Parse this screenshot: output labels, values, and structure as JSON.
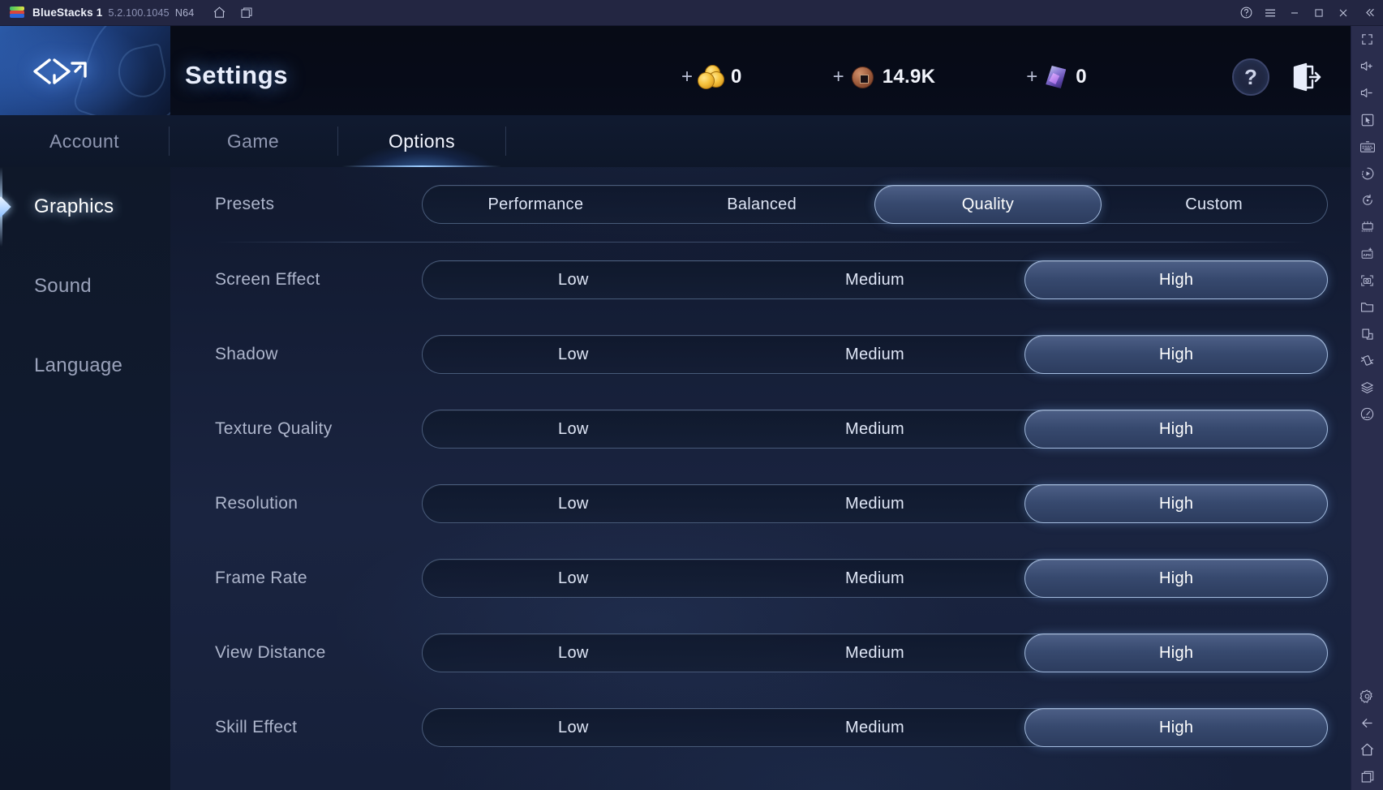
{
  "titlebar": {
    "app_name": "BlueStacks 1",
    "version": "5.2.100.1045",
    "instance": "N64",
    "icons": {
      "home": "home-icon",
      "instances": "instance-manager-icon",
      "help": "help-icon",
      "menu": "hamburger-menu-icon",
      "minimize": "minimize-icon",
      "maximize": "maximize-icon",
      "close": "close-icon",
      "collapse": "collapse-icon"
    }
  },
  "sidetool": {
    "items": [
      {
        "name": "fullscreen-icon"
      },
      {
        "name": "volume-up-icon"
      },
      {
        "name": "volume-down-icon"
      },
      {
        "name": "cursor-icon"
      },
      {
        "name": "keyboard-controls-icon"
      },
      {
        "name": "macro-recorder-icon"
      },
      {
        "name": "rotate-icon"
      },
      {
        "name": "multi-instance-icon"
      },
      {
        "name": "install-apk-icon"
      },
      {
        "name": "screenshot-icon"
      },
      {
        "name": "media-manager-icon"
      },
      {
        "name": "multi-window-icon"
      },
      {
        "name": "shake-icon"
      },
      {
        "name": "eco-mode-icon"
      },
      {
        "name": "performance-meter-icon"
      }
    ],
    "bottom_items": [
      {
        "name": "settings-gear-icon"
      },
      {
        "name": "back-icon"
      },
      {
        "name": "home-icon"
      },
      {
        "name": "recents-icon"
      }
    ]
  },
  "header": {
    "title": "Settings",
    "logo": "game-logo-icon",
    "help_label": "?",
    "exit": "exit-icon",
    "currencies": [
      {
        "name": "gold",
        "icon": "gold-coin-icon",
        "plus": "+",
        "value": "0"
      },
      {
        "name": "copper",
        "icon": "copper-coin-icon",
        "plus": "+",
        "value": "14.9K"
      },
      {
        "name": "crystal",
        "icon": "crystal-icon",
        "plus": "+",
        "value": "0"
      }
    ]
  },
  "tabs": [
    {
      "label": "Account",
      "active": false
    },
    {
      "label": "Game",
      "active": false
    },
    {
      "label": "Options",
      "active": true
    }
  ],
  "sidebar": {
    "items": [
      {
        "label": "Graphics",
        "active": true
      },
      {
        "label": "Sound",
        "active": false
      },
      {
        "label": "Language",
        "active": false
      }
    ]
  },
  "settings": {
    "presets": {
      "label": "Presets",
      "options": [
        "Performance",
        "Balanced",
        "Quality",
        "Custom"
      ],
      "selected": "Quality"
    },
    "rows": [
      {
        "label": "Screen Effect",
        "options": [
          "Low",
          "Medium",
          "High"
        ],
        "selected": "High"
      },
      {
        "label": "Shadow",
        "options": [
          "Low",
          "Medium",
          "High"
        ],
        "selected": "High"
      },
      {
        "label": "Texture Quality",
        "options": [
          "Low",
          "Medium",
          "High"
        ],
        "selected": "High"
      },
      {
        "label": "Resolution",
        "options": [
          "Low",
          "Medium",
          "High"
        ],
        "selected": "High"
      },
      {
        "label": "Frame Rate",
        "options": [
          "Low",
          "Medium",
          "High"
        ],
        "selected": "High"
      },
      {
        "label": "View Distance",
        "options": [
          "Low",
          "Medium",
          "High"
        ],
        "selected": "High"
      },
      {
        "label": "Skill Effect",
        "options": [
          "Low",
          "Medium",
          "High"
        ],
        "selected": "High"
      }
    ]
  },
  "colors": {
    "titlebar_bg": "#232642",
    "sidetool_bg": "#2a2d4d",
    "accent_blue": "#5698f5",
    "selected_pill": "#37496e",
    "text_primary": "#f2f5ff",
    "text_muted": "#9aa2ba"
  }
}
